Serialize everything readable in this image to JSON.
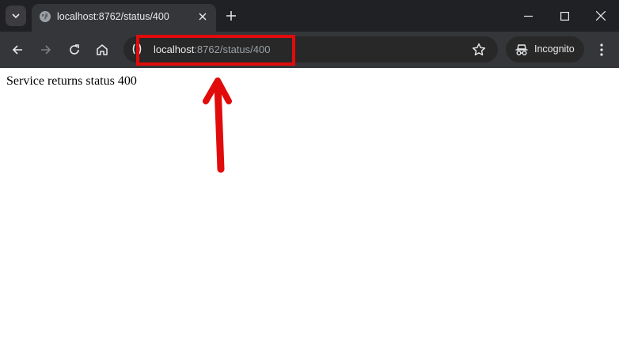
{
  "tab": {
    "title": "localhost:8762/status/400"
  },
  "address_bar": {
    "host": "localhost",
    "path": ":8762/status/400"
  },
  "profile": {
    "label": "Incognito"
  },
  "page": {
    "text": "Service returns status 400"
  },
  "colors": {
    "tabstrip": "#202124",
    "toolbar": "#35363a",
    "annotation": "#e10b0b"
  },
  "icons": [
    "tab-search-icon",
    "globe-icon",
    "close-icon",
    "plus-icon",
    "minimize-icon",
    "maximize-icon",
    "back-icon",
    "forward-icon",
    "reload-icon",
    "home-icon",
    "site-info-icon",
    "star-icon",
    "incognito-icon",
    "kebab-menu-icon",
    "arrow-icon"
  ]
}
